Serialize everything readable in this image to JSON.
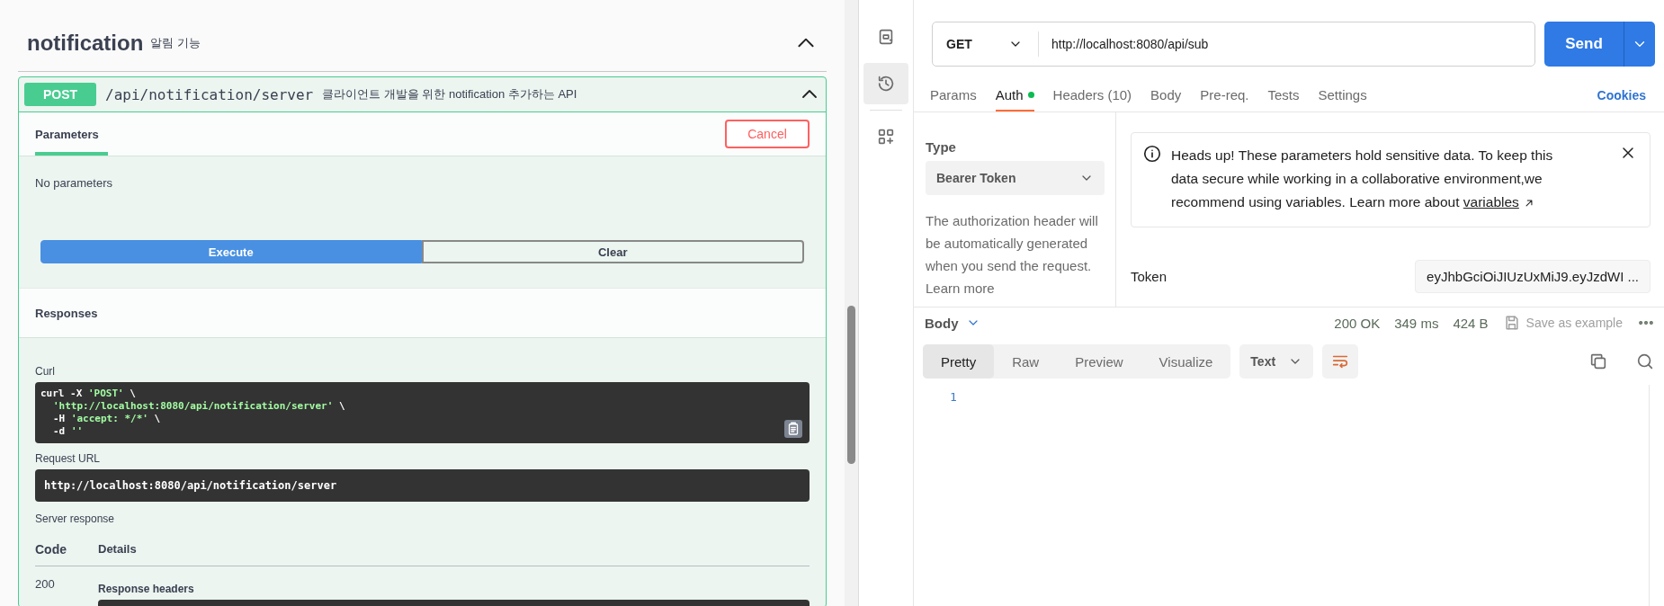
{
  "swagger": {
    "section": {
      "title": "notification",
      "description": "알림 기능",
      "expanded": true
    },
    "operation": {
      "method": "POST",
      "path": "/api/notification/server",
      "summary": "클라이언트 개발을 위한 notification 추가하는 API",
      "expanded": true
    },
    "parameters_tab": {
      "label": "Parameters",
      "selected": true
    },
    "cancel_button": "Cancel",
    "no_parameters": "No parameters",
    "execute_button": "Execute",
    "clear_button": "Clear",
    "responses_title": "Responses",
    "curl_label": "Curl",
    "curl_lines": [
      {
        "indented": false,
        "parts": [
          {
            "text": "curl -X ",
            "kind": "plain"
          },
          {
            "text": "'POST'",
            "kind": "string"
          },
          {
            "text": " \\",
            "kind": "plain"
          }
        ]
      },
      {
        "indented": true,
        "parts": [
          {
            "text": "'http://localhost:8080/api/notification/server'",
            "kind": "string"
          },
          {
            "text": " \\",
            "kind": "plain"
          }
        ]
      },
      {
        "indented": true,
        "parts": [
          {
            "text": "-H ",
            "kind": "plain"
          },
          {
            "text": "'accept: */*'",
            "kind": "string"
          },
          {
            "text": " \\",
            "kind": "plain"
          }
        ]
      },
      {
        "indented": true,
        "parts": [
          {
            "text": "-d ",
            "kind": "plain"
          },
          {
            "text": "''",
            "kind": "string"
          }
        ]
      }
    ],
    "request_url_label": "Request URL",
    "request_url": "http://localhost:8080/api/notification/server",
    "server_response_label": "Server response",
    "columns": [
      "Code",
      "Details"
    ],
    "rows": [
      {
        "code": "200",
        "details_label": "Response headers"
      }
    ]
  },
  "postman": {
    "sidebar_items": [
      {
        "selected": false
      },
      {
        "selected": true
      },
      {
        "selected": false
      }
    ],
    "method": "GET",
    "url": "http://localhost:8080/api/sub",
    "send_button": "Send",
    "tabs": [
      {
        "label": "Params",
        "selected": false,
        "indicator": false
      },
      {
        "label": "Auth",
        "selected": true,
        "indicator": true
      },
      {
        "label": "Headers (10)",
        "selected": false,
        "indicator": false
      },
      {
        "label": "Body",
        "selected": false,
        "indicator": false
      },
      {
        "label": "Pre-req.",
        "selected": false,
        "indicator": false
      },
      {
        "label": "Tests",
        "selected": false,
        "indicator": false
      },
      {
        "label": "Settings",
        "selected": false,
        "indicator": false
      }
    ],
    "cookies_link": "Cookies",
    "auth": {
      "type_label": "Type",
      "type_value": "Bearer Token",
      "description": "The authorization header will be automatically generated when you send the request. Learn more",
      "notice": {
        "text": "Heads up! These parameters hold sensitive data. To keep this data secure while working in a collaborative environment,we recommend using variables. Learn more about ",
        "link": "variables"
      },
      "token_label": "Token",
      "token_value": "eyJhbGciOiJIUzUxMiJ9.eyJzdWI ..."
    },
    "response": {
      "body_label": "Body",
      "status": "200 OK",
      "time": "349 ms",
      "size": "424 B",
      "save_button": "Save as example",
      "view_tabs": [
        {
          "label": "Pretty",
          "selected": true
        },
        {
          "label": "Raw",
          "selected": false
        },
        {
          "label": "Preview",
          "selected": false
        },
        {
          "label": "Visualize",
          "selected": false
        }
      ],
      "format": "Text",
      "line_numbers": [
        "1"
      ]
    }
  }
}
